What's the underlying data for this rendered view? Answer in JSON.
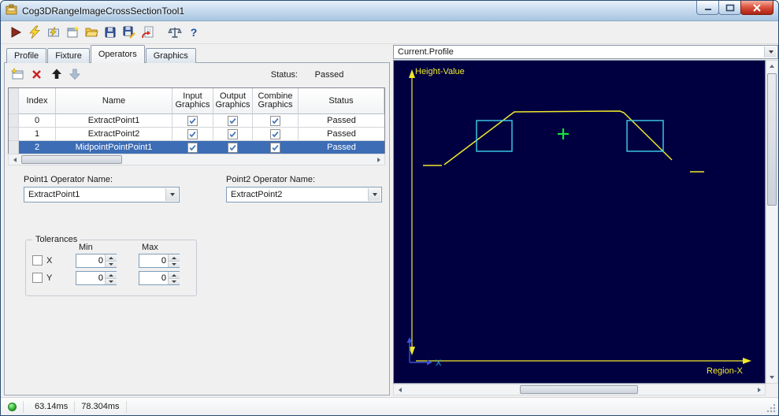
{
  "window": {
    "title": "Cog3DRangeImageCrossSectionTool1"
  },
  "toolbar": {
    "help_glyph": "?",
    "icon_names": [
      "run",
      "electric-run",
      "electric-tool",
      "new-window",
      "open",
      "save",
      "save-as",
      "import",
      "measure",
      "help"
    ]
  },
  "tabs": {
    "items": [
      "Profile",
      "Fixture",
      "Operators",
      "Graphics"
    ],
    "active": "Operators"
  },
  "operators": {
    "status_label": "Status:",
    "status_value": "Passed",
    "table": {
      "headers": {
        "index": "Index",
        "name": "Name",
        "input": "Input Graphics",
        "output": "Output Graphics",
        "combine": "Combine Graphics",
        "status": "Status"
      },
      "rows": [
        {
          "index": "0",
          "name": "ExtractPoint1",
          "input_graphics": true,
          "output_graphics": true,
          "combine_graphics": true,
          "status": "Passed",
          "selected": false
        },
        {
          "index": "1",
          "name": "ExtractPoint2",
          "input_graphics": true,
          "output_graphics": true,
          "combine_graphics": true,
          "status": "Passed",
          "selected": false
        },
        {
          "index": "2",
          "name": "MidpointPointPoint1",
          "input_graphics": true,
          "output_graphics": true,
          "combine_graphics": true,
          "status": "Passed",
          "selected": true
        }
      ]
    },
    "point1": {
      "label": "Point1 Operator Name:",
      "value": "ExtractPoint1"
    },
    "point2": {
      "label": "Point2 Operator Name:",
      "value": "ExtractPoint2"
    },
    "tolerances": {
      "title": "Tolerances",
      "min_header": "Min",
      "max_header": "Max",
      "x": {
        "label": "X",
        "min": "0",
        "max": "0",
        "checked": false
      },
      "y": {
        "label": "Y",
        "min": "0",
        "max": "0",
        "checked": false
      }
    }
  },
  "profile_view": {
    "selector_value": "Current.Profile",
    "y_axis_label": "Height-Value",
    "x_axis_label": "Region-X",
    "origin_axis_label": "X",
    "colors": {
      "display_background": "#000040",
      "profile_line": "#f0e92a",
      "search_regions": "#3fd0ee",
      "result_marker": "#17e23a",
      "mini_axis": "#3852d8",
      "mini_axis_label": "#2aa3e8"
    }
  },
  "status_bar": {
    "time1": "63.14ms",
    "time2": "78.304ms"
  }
}
